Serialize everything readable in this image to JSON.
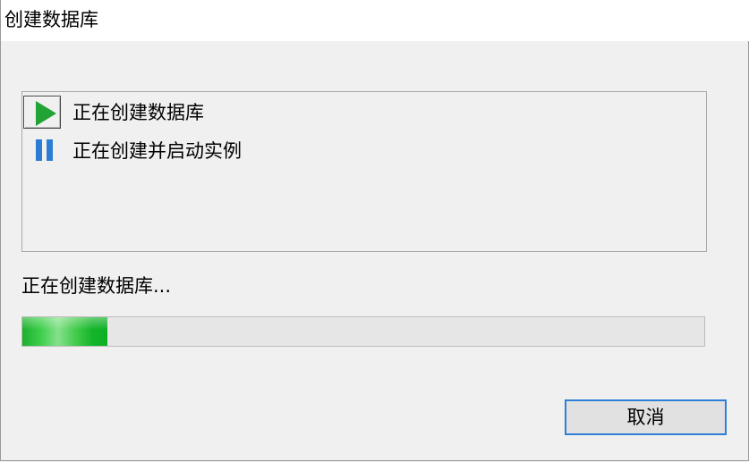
{
  "window": {
    "title": "创建数据库"
  },
  "tasks": [
    {
      "label": "正在创建数据库",
      "state": "running",
      "icon": "play-icon",
      "color": "#21a336"
    },
    {
      "label": "正在创建并启动实例",
      "state": "pending",
      "icon": "pause-icon",
      "color": "#2b7cd3"
    }
  ],
  "status": {
    "text": "正在创建数据库..."
  },
  "progress": {
    "fraction": 0.125,
    "color": "#1cb02e"
  },
  "buttons": {
    "cancel_label": "取消"
  }
}
